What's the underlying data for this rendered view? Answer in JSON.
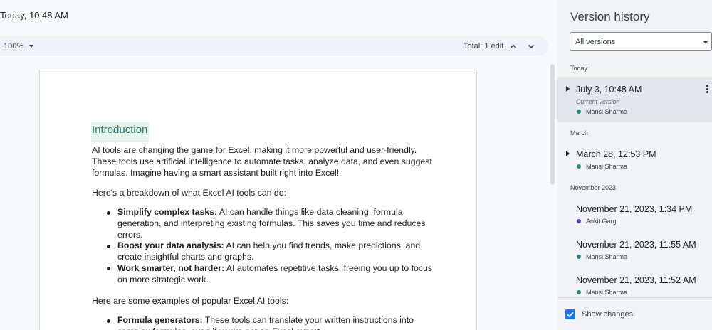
{
  "document": {
    "title": "Today, 10:48 AM",
    "zoom": "100%",
    "total_edits": "Total: 1 edit",
    "heading": "Introduction",
    "para1": "AI tools are changing the game for Excel, making it more powerful and user-friendly. These tools use artificial intelligence to automate tasks, analyze data, and even suggest formulas.  Imagine having a smart assistant built right into Excel!",
    "para2": "Here's a breakdown of what Excel AI tools can do:",
    "bullets": [
      {
        "bold": "Simplify complex tasks:",
        "text": " AI can handle things like data cleaning, formula generation, and interpreting existing formulas. This saves you time and reduces errors."
      },
      {
        "bold": "Boost your data analysis:",
        "text": " AI can help you find trends, make predictions, and create insightful charts and graphs."
      },
      {
        "bold": "Work smarter, not harder:",
        "text": " AI automates repetitive tasks, freeing you up to focus on more strategic work."
      }
    ],
    "para3": "Here are some examples of popular Excel AI tools:",
    "bullets2": [
      {
        "bold": "Formula generators:",
        "text": " These tools can translate your written instructions into complex formulas, even if you're not an Excel expert."
      }
    ]
  },
  "panel": {
    "title": "Version history",
    "filter": "All versions",
    "groups": {
      "today": "Today",
      "march": "March",
      "nov2023": "November 2023"
    },
    "versions": [
      {
        "date": "July 3, 10:48 AM",
        "current": "Current version",
        "author": "Mansi Sharma",
        "dot_color": "#1e8e7e"
      },
      {
        "date": "March 28, 12:53 PM",
        "author": "Mansi Sharma",
        "dot_color": "#1e8e7e"
      },
      {
        "date": "November 21, 2023, 1:34 PM",
        "author": "Ankit Garg",
        "dot_color": "#5b3fc4"
      },
      {
        "date": "November 21, 2023, 11:55 AM",
        "author": "Mansi Sharma",
        "dot_color": "#1e8e7e"
      },
      {
        "date": "November 21, 2023, 11:52 AM",
        "author": "Mansi Sharma",
        "dot_color": "#1e8e7e"
      }
    ],
    "show_changes": "Show changes"
  },
  "colors": {
    "accent": "#1a73e8",
    "heading_highlight": "#e6f4ee",
    "heading_text": "#1e7f6a"
  },
  "icons": [
    "chevron-up-icon",
    "chevron-down-icon",
    "dropdown-caret-icon",
    "more-vert-icon",
    "expand-arrow-icon",
    "checkbox-checked-icon"
  ]
}
